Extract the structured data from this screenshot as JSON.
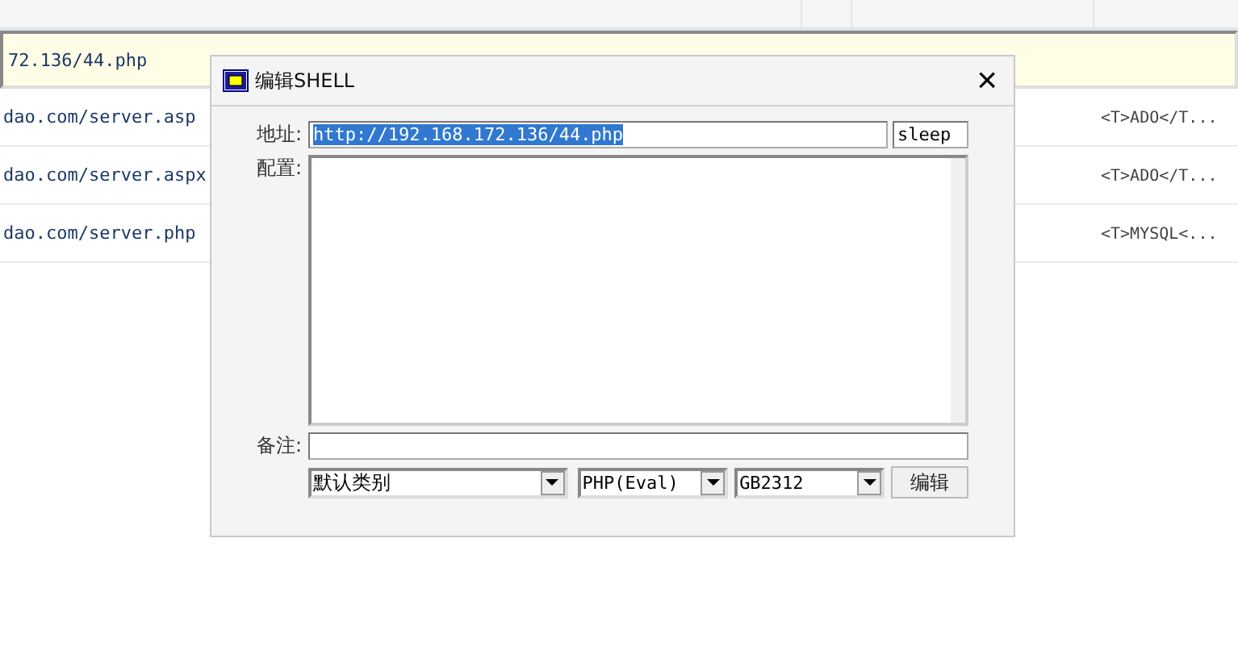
{
  "table": {
    "rows": [
      {
        "url": "72.136/44.php",
        "note": "",
        "selected": true
      },
      {
        "url": "dao.com/server.asp",
        "note": "<T>ADO</T...",
        "selected": false
      },
      {
        "url": "dao.com/server.aspx",
        "note": "<T>ADO</T...",
        "selected": false
      },
      {
        "url": "dao.com/server.php",
        "note": "<T>MYSQL<...",
        "selected": false
      }
    ]
  },
  "dialog": {
    "title": "编辑SHELL",
    "close": "×",
    "address_label": "地址:",
    "address_value": "http://192.168.172.136/44.php",
    "address_selected": true,
    "sleep_value": "sleep",
    "config_label": "配置:",
    "note_label": "备注:",
    "category": "默认类别",
    "script_type": "PHP(Eval)",
    "encoding": "GB2312",
    "submit": "编辑"
  }
}
